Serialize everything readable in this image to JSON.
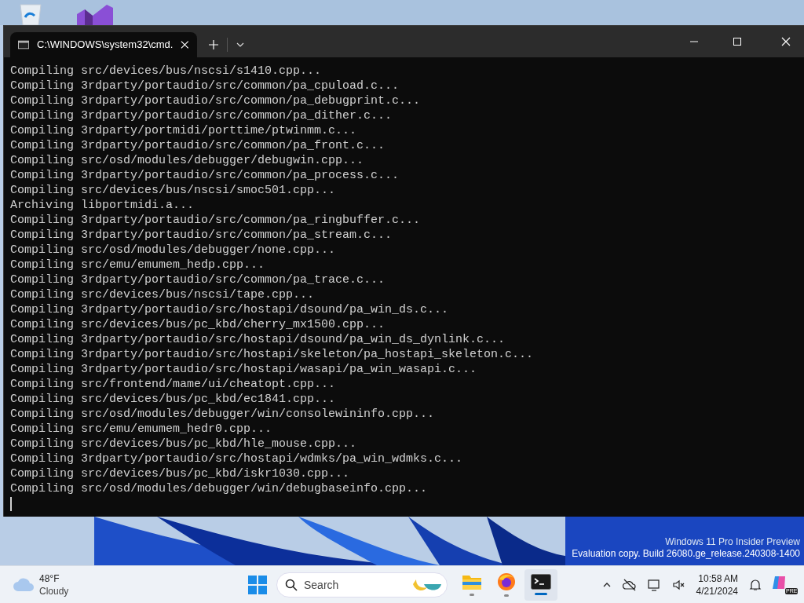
{
  "window": {
    "tabs": [
      {
        "title": "C:\\WINDOWS\\system32\\cmd.",
        "selected": true
      }
    ]
  },
  "console": {
    "lines": [
      "Compiling src/devices/bus/nscsi/s1410.cpp...",
      "Compiling 3rdparty/portaudio/src/common/pa_cpuload.c...",
      "Compiling 3rdparty/portaudio/src/common/pa_debugprint.c...",
      "Compiling 3rdparty/portaudio/src/common/pa_dither.c...",
      "Compiling 3rdparty/portmidi/porttime/ptwinmm.c...",
      "Compiling 3rdparty/portaudio/src/common/pa_front.c...",
      "Compiling src/osd/modules/debugger/debugwin.cpp...",
      "Compiling 3rdparty/portaudio/src/common/pa_process.c...",
      "Compiling src/devices/bus/nscsi/smoc501.cpp...",
      "Archiving libportmidi.a...",
      "Compiling 3rdparty/portaudio/src/common/pa_ringbuffer.c...",
      "Compiling 3rdparty/portaudio/src/common/pa_stream.c...",
      "Compiling src/osd/modules/debugger/none.cpp...",
      "Compiling src/emu/emumem_hedp.cpp...",
      "Compiling 3rdparty/portaudio/src/common/pa_trace.c...",
      "Compiling src/devices/bus/nscsi/tape.cpp...",
      "Compiling 3rdparty/portaudio/src/hostapi/dsound/pa_win_ds.c...",
      "Compiling src/devices/bus/pc_kbd/cherry_mx1500.cpp...",
      "Compiling 3rdparty/portaudio/src/hostapi/dsound/pa_win_ds_dynlink.c...",
      "Compiling 3rdparty/portaudio/src/hostapi/skeleton/pa_hostapi_skeleton.c...",
      "Compiling 3rdparty/portaudio/src/hostapi/wasapi/pa_win_wasapi.c...",
      "Compiling src/frontend/mame/ui/cheatopt.cpp...",
      "Compiling src/devices/bus/pc_kbd/ec1841.cpp...",
      "Compiling src/osd/modules/debugger/win/consolewininfo.cpp...",
      "Compiling src/emu/emumem_hedr0.cpp...",
      "Compiling src/devices/bus/pc_kbd/hle_mouse.cpp...",
      "Compiling 3rdparty/portaudio/src/hostapi/wdmks/pa_win_wdmks.c...",
      "Compiling src/devices/bus/pc_kbd/iskr1030.cpp...",
      "Compiling src/osd/modules/debugger/win/debugbaseinfo.cpp..."
    ]
  },
  "desktop": {
    "watermark": [
      "Windows 11 Pro Insider Preview",
      "Evaluation copy. Build 26080.ge_release.240308-1400"
    ]
  },
  "taskbar": {
    "weather": {
      "temperature": "48°F",
      "condition": "Cloudy"
    },
    "search": {
      "placeholder": "Search"
    },
    "apps": [
      {
        "kind": "explorer",
        "active": false
      },
      {
        "kind": "browser",
        "active": false
      },
      {
        "kind": "terminal",
        "active": true
      }
    ],
    "clock": {
      "time": "10:58 AM",
      "date": "4/21/2024"
    },
    "copilot_badge": "PRE"
  }
}
